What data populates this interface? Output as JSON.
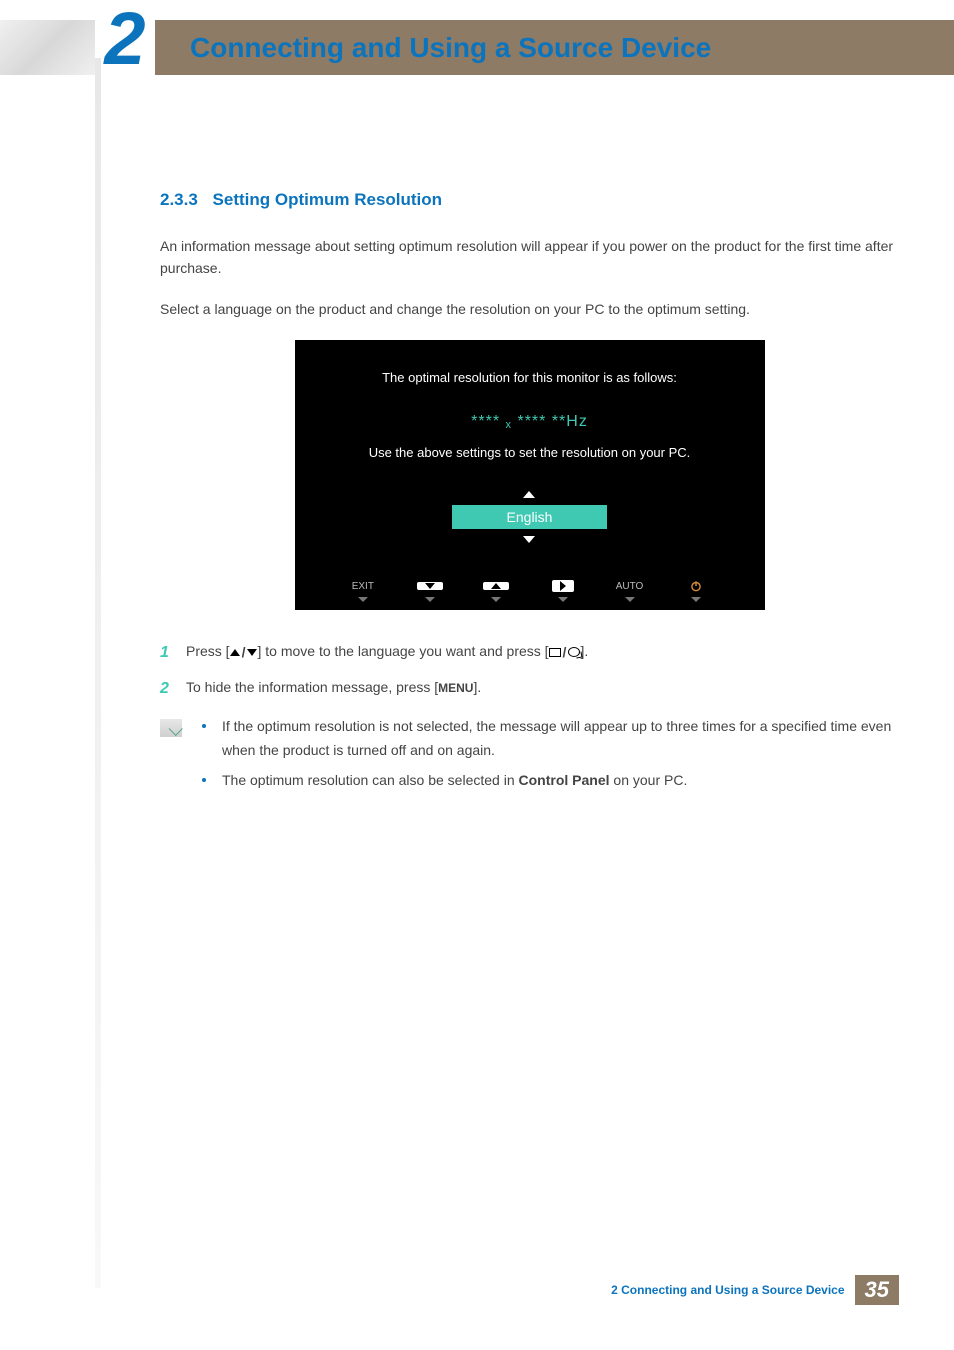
{
  "header": {
    "chapter_number": "2",
    "chapter_title": "Connecting and Using a Source Device"
  },
  "section": {
    "number": "2.3.3",
    "title": "Setting Optimum Resolution"
  },
  "paragraphs": {
    "p1": "An information message about setting optimum resolution will appear if you power on the product for the first time after purchase.",
    "p2": "Select a language on the product and change the resolution on your PC to the optimum setting."
  },
  "osd": {
    "line1": "The optimal resolution for this monitor is as follows:",
    "resolution": "**** x **** **Hz",
    "line3": "Use the above settings to set the resolution on your PC.",
    "language": "English",
    "buttons": {
      "exit": "EXIT",
      "auto": "AUTO"
    }
  },
  "steps": {
    "s1_prefix": "Press [",
    "s1_mid": "] to move to the language you want and press [",
    "s1_suffix": "].",
    "s2_prefix": "To hide the information message, press [",
    "s2_menu": "MENU",
    "s2_suffix": "]."
  },
  "notes": {
    "n1": "If the optimum resolution is not selected, the message will appear up to three times for a specified time even when the product is turned off and on again.",
    "n2_prefix": "The optimum resolution can also be selected in ",
    "n2_bold": "Control Panel",
    "n2_suffix": " on your PC."
  },
  "footer": {
    "text": "2 Connecting and Using a Source Device",
    "page": "35"
  }
}
